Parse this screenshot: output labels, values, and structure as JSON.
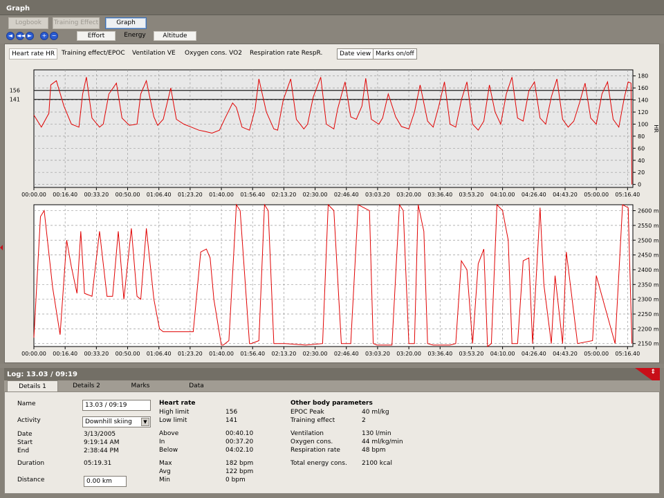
{
  "window": {
    "title": "Graph"
  },
  "top_tabs": [
    "Logbook",
    "Training Effect",
    "Graph"
  ],
  "nav_buttons": [
    "◄",
    "◄◄",
    "►",
    "+",
    "−"
  ],
  "sub_tabs": [
    "Effort",
    "Energy",
    "Altitude"
  ],
  "selectors": [
    "Heart rate HR",
    "Training effect/EPOC",
    "Ventilation VE",
    "Oxygen cons. VO2",
    "Respiration rate RespR."
  ],
  "view_buttons": [
    "Date view",
    "Marks on/off"
  ],
  "hr_chart": {
    "limit_labels": [
      "156",
      "141"
    ],
    "limits": [
      156,
      141
    ],
    "y_ticks": [
      0,
      20,
      40,
      60,
      80,
      100,
      120,
      140,
      160,
      180
    ],
    "ylabel": "HR",
    "ylim": [
      -5,
      190
    ]
  },
  "alt_chart": {
    "y_ticks": [
      2150,
      2200,
      2250,
      2300,
      2350,
      2400,
      2450,
      2500,
      2550,
      2600
    ],
    "y_unit": "m",
    "ylim": [
      2140,
      2620
    ]
  },
  "time_ticks": [
    "00:00.00",
    "00:16.40",
    "00:33.20",
    "00:50.00",
    "01:06.40",
    "01:23.20",
    "01:40.00",
    "01:56.40",
    "02:13.20",
    "02:30.00",
    "02:46.40",
    "03:03.20",
    "03:20.00",
    "03:36.40",
    "03:53.20",
    "04:10.00",
    "04:26.40",
    "04:43.20",
    "05:00.00",
    "05:16.40"
  ],
  "chart_data": [
    {
      "type": "line",
      "x_unit": "minutes",
      "xlim": [
        0,
        319.5
      ],
      "ylabel": "HR",
      "ylim": [
        -5,
        190
      ],
      "y_ticks": [
        0,
        20,
        40,
        60,
        80,
        100,
        120,
        140,
        160,
        180
      ],
      "x_tick_labels": [
        "00:00.00",
        "00:16.40",
        "00:33.20",
        "00:50.00",
        "01:06.40",
        "01:23.20",
        "01:40.00",
        "01:56.40",
        "02:13.20",
        "02:30.00",
        "02:46.40",
        "03:03.20",
        "03:20.00",
        "03:36.40",
        "03:53.20",
        "04:10.00",
        "04:26.40",
        "04:43.20",
        "05:00.00",
        "05:16.40"
      ],
      "horizontal_lines": [
        156,
        141
      ],
      "grid": true,
      "series": [
        {
          "color": "#e00000",
          "x": [
            0,
            4,
            8,
            9,
            12,
            16,
            20,
            24,
            26,
            28,
            31,
            35,
            37,
            40,
            44,
            47,
            51,
            55,
            57,
            60,
            64,
            66,
            69,
            73,
            76,
            80,
            84,
            88,
            91,
            95,
            99,
            102,
            106,
            108,
            111,
            115,
            118,
            120,
            124,
            128,
            130,
            133,
            137,
            140,
            144,
            146,
            149,
            153,
            156,
            160,
            162,
            166,
            169,
            172,
            175,
            177,
            180,
            184,
            186,
            189,
            193,
            196,
            200,
            203,
            206,
            210,
            213,
            216,
            219,
            222,
            225,
            228,
            231,
            234,
            237,
            240,
            243,
            246,
            249,
            252,
            255,
            258,
            261,
            264,
            267,
            270,
            273,
            276,
            279,
            282,
            285,
            288,
            291,
            294,
            297,
            300,
            303,
            306,
            309,
            312,
            315,
            317,
            318.5,
            319
          ],
          "values": [
            115,
            95,
            118,
            165,
            172,
            130,
            100,
            95,
            150,
            178,
            110,
            95,
            100,
            150,
            168,
            110,
            98,
            100,
            150,
            172,
            112,
            98,
            108,
            160,
            108,
            100,
            95,
            90,
            88,
            85,
            90,
            110,
            135,
            128,
            95,
            90,
            125,
            175,
            120,
            92,
            90,
            140,
            175,
            108,
            92,
            100,
            145,
            178,
            100,
            92,
            125,
            170,
            112,
            108,
            130,
            176,
            108,
            100,
            110,
            150,
            112,
            96,
            92,
            120,
            165,
            105,
            95,
            130,
            170,
            100,
            95,
            140,
            170,
            100,
            90,
            105,
            165,
            120,
            100,
            150,
            178,
            110,
            105,
            155,
            170,
            110,
            100,
            145,
            175,
            108,
            95,
            105,
            135,
            168,
            110,
            100,
            150,
            170,
            108,
            95,
            145,
            170,
            168,
            0
          ]
        }
      ]
    },
    {
      "type": "line",
      "x_unit": "minutes",
      "xlim": [
        0,
        319.5
      ],
      "ylim": [
        2140,
        2620
      ],
      "y_ticks": [
        2150,
        2200,
        2250,
        2300,
        2350,
        2400,
        2450,
        2500,
        2550,
        2600
      ],
      "y_unit": "m",
      "x_tick_labels": [
        "00:00.00",
        "00:16.40",
        "00:33.20",
        "00:50.00",
        "01:06.40",
        "01:23.20",
        "01:40.00",
        "01:56.40",
        "02:13.20",
        "02:30.00",
        "02:46.40",
        "03:03.20",
        "03:20.00",
        "03:36.40",
        "03:53.20",
        "04:10.00",
        "04:26.40",
        "04:43.20",
        "05:00.00",
        "05:16.40"
      ],
      "grid": true,
      "series": [
        {
          "color": "#e00000",
          "x": [
            0,
            3.5,
            5.5,
            10,
            14,
            17.5,
            20,
            23,
            25,
            27,
            31,
            35,
            39,
            42,
            45,
            48,
            52,
            55,
            57,
            60,
            64,
            67,
            69,
            71,
            85,
            89,
            92,
            94,
            96,
            100,
            101,
            104,
            107,
            108,
            110,
            115,
            116,
            120,
            123,
            125,
            128,
            134,
            145,
            154,
            157,
            160,
            164,
            167,
            169,
            173,
            179,
            181,
            183,
            187,
            191,
            195,
            197,
            200,
            203,
            205,
            208,
            210,
            213,
            216,
            219,
            222,
            225,
            228,
            231,
            234,
            237,
            240,
            242,
            244,
            247,
            250,
            253,
            255,
            258,
            261,
            264,
            266,
            270,
            272,
            276,
            278,
            282,
            284,
            290,
            298,
            300,
            310,
            314,
            317,
            319
          ],
          "values": [
            2170,
            2580,
            2600,
            2340,
            2180,
            2500,
            2410,
            2320,
            2530,
            2320,
            2310,
            2530,
            2310,
            2310,
            2530,
            2300,
            2540,
            2310,
            2300,
            2540,
            2300,
            2200,
            2190,
            2190,
            2190,
            2460,
            2470,
            2440,
            2300,
            2145,
            2145,
            2160,
            2500,
            2620,
            2600,
            2150,
            2150,
            2160,
            2620,
            2600,
            2150,
            2150,
            2145,
            2150,
            2620,
            2600,
            2150,
            2150,
            2150,
            2620,
            2600,
            2150,
            2145,
            2145,
            2145,
            2620,
            2600,
            2150,
            2150,
            2620,
            2530,
            2150,
            2145,
            2145,
            2145,
            2145,
            2150,
            2430,
            2400,
            2150,
            2420,
            2470,
            2140,
            2150,
            2620,
            2600,
            2500,
            2150,
            2150,
            2430,
            2440,
            2150,
            2610,
            2350,
            2150,
            2380,
            2150,
            2460,
            2150,
            2160,
            2380,
            2150,
            2620,
            2610,
            2150
          ]
        }
      ]
    }
  ],
  "log": {
    "title": "Log: 13.03 / 09:19",
    "tabs": [
      "Details 1",
      "Details 2",
      "Marks",
      "Data"
    ],
    "name_label": "Name",
    "name_value": "13.03 / 09:19",
    "activity_label": "Activity",
    "activity_value": "Downhill skiing",
    "date_label": "Date",
    "date_value": "3/13/2005",
    "start_label": "Start",
    "start_value": "9:19:14 AM",
    "end_label": "End",
    "end_value": "2:38:44 PM",
    "duration_label": "Duration",
    "duration_value": "05:19.31",
    "distance_label": "Distance",
    "distance_value": "0.00 km",
    "hr_header": "Heart rate",
    "hr_rows": [
      {
        "label": "High limit",
        "value": "156"
      },
      {
        "label": "Low limit",
        "value": "141"
      },
      {
        "label": "Above",
        "value": "00:40.10"
      },
      {
        "label": "In",
        "value": "00:37.20"
      },
      {
        "label": "Below",
        "value": "04:02.10"
      },
      {
        "label": "Max",
        "value": "182 bpm"
      },
      {
        "label": "Avg",
        "value": "122 bpm"
      },
      {
        "label": "Min",
        "value": "0 bpm"
      }
    ],
    "obp_header": "Other body parameters",
    "obp_rows": [
      {
        "label": "EPOC Peak",
        "value": "40 ml/kg"
      },
      {
        "label": "Training effect",
        "value": "2"
      },
      {
        "label": "Ventilation",
        "value": "130 l/min"
      },
      {
        "label": "Oxygen cons.",
        "value": "44 ml/kg/min"
      },
      {
        "label": "Respiration rate",
        "value": "48 bpm"
      },
      {
        "label": "Total energy cons.",
        "value": "2100 kcal"
      }
    ]
  }
}
